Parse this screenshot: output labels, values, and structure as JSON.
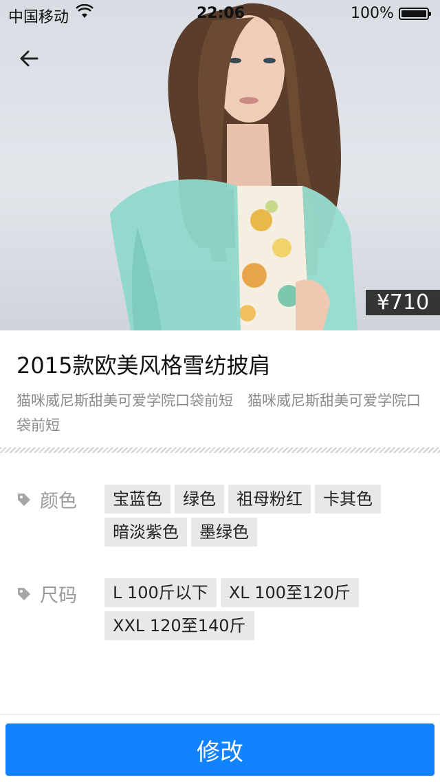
{
  "status_bar": {
    "carrier": "中国移动",
    "time": "22:06",
    "battery_percent": "100%"
  },
  "product": {
    "price": "¥710",
    "title": "2015款欧美风格雪纺披肩",
    "description": "猫咪威尼斯甜美可爱学院口袋前短　猫咪威尼斯甜美可爱学院口袋前短"
  },
  "attributes": {
    "color": {
      "label": "颜色",
      "options": [
        "宝蓝色",
        "绿色",
        "祖母粉红",
        "卡其色",
        "暗淡紫色",
        "墨绿色"
      ]
    },
    "size": {
      "label": "尺码",
      "options": [
        "L 100斤以下",
        "XL 100至120斤",
        "XXL 120至140斤"
      ]
    }
  },
  "actions": {
    "submit_label": "修改"
  },
  "colors": {
    "primary_button": "#1283ff",
    "chip_bg": "#e8e8e8",
    "price_tag_bg": "#1e1e1e"
  },
  "icons": {
    "back": "arrow-left-icon",
    "tag": "tag-icon",
    "wifi": "wifi-icon",
    "battery": "battery-icon"
  }
}
